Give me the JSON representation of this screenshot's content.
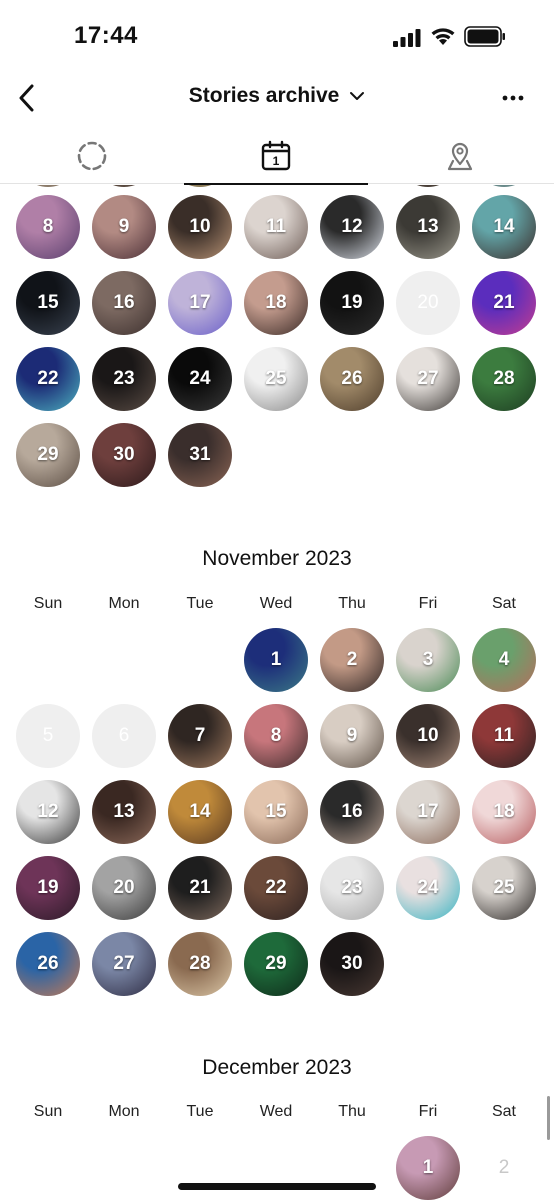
{
  "status_bar": {
    "time": "17:44"
  },
  "header": {
    "title": "Stories archive"
  },
  "tabs": [
    {
      "name": "tab-stories-loading",
      "icon": "dashed-circle-icon",
      "active": false
    },
    {
      "name": "tab-calendar",
      "icon": "calendar-icon",
      "calendar_number": "1",
      "active": true
    },
    {
      "name": "tab-map",
      "icon": "map-pin-icon",
      "active": false
    }
  ],
  "october": {
    "days": [
      {
        "d": "8",
        "c": [
          "#b07fa7",
          "#5a3f6d"
        ]
      },
      {
        "d": "9",
        "c": [
          "#b28a83",
          "#4a2e35"
        ]
      },
      {
        "d": "10",
        "c": [
          "#3a2e28",
          "#b89375"
        ]
      },
      {
        "d": "11",
        "c": [
          "#dcd4cf",
          "#6d5c55"
        ]
      },
      {
        "d": "12",
        "c": [
          "#2a2a2a",
          "#d8dde6"
        ]
      },
      {
        "d": "13",
        "c": [
          "#3c3a35",
          "#9d9a8e"
        ]
      },
      {
        "d": "14",
        "c": [
          "#63a5a8",
          "#3b2d2a"
        ]
      },
      {
        "d": "15",
        "c": [
          "#101318",
          "#3b4452"
        ]
      },
      {
        "d": "16",
        "c": [
          "#7d6a62",
          "#3d302e"
        ]
      },
      {
        "d": "17",
        "c": [
          "#bfb3d9",
          "#6a5fc9"
        ]
      },
      {
        "d": "18",
        "c": [
          "#c49c8e",
          "#3a2a26"
        ]
      },
      {
        "d": "19",
        "c": [
          "#121212",
          "#2d2d2d"
        ]
      },
      {
        "d": "20",
        "c": [],
        "empty": true
      },
      {
        "d": "21",
        "c": [
          "#5b2dbd",
          "#c63d8f"
        ]
      },
      {
        "d": "22",
        "c": [
          "#1c2b76",
          "#4eb3c0"
        ]
      },
      {
        "d": "23",
        "c": [
          "#1a1717",
          "#5b4d45"
        ]
      },
      {
        "d": "24",
        "c": [
          "#0a0a0a",
          "#3a3a3a"
        ]
      },
      {
        "d": "25",
        "c": [
          "#f0f0f0",
          "#8a8a8a"
        ]
      },
      {
        "d": "26",
        "c": [
          "#a28b6a",
          "#4e3d2b"
        ]
      },
      {
        "d": "27",
        "c": [
          "#e5e0dc",
          "#3e3a37"
        ]
      },
      {
        "d": "28",
        "c": [
          "#3c7c3f",
          "#1d3c21"
        ]
      },
      {
        "d": "29",
        "c": [
          "#b7a99b",
          "#5c4e44"
        ]
      },
      {
        "d": "30",
        "c": [
          "#6e3f3d",
          "#2d1a1b"
        ]
      },
      {
        "d": "31",
        "c": [
          "#3a2e2c",
          "#8b6555"
        ]
      }
    ]
  },
  "november": {
    "title": "November 2023",
    "weekdays": [
      "Sun",
      "Mon",
      "Tue",
      "Wed",
      "Thu",
      "Fri",
      "Sat"
    ],
    "days": [
      {
        "d": "",
        "c": [],
        "blank": true
      },
      {
        "d": "",
        "c": [],
        "blank": true
      },
      {
        "d": "",
        "c": [],
        "blank": true
      },
      {
        "d": "1",
        "c": [
          "#1d2e7a",
          "#3c7c86"
        ]
      },
      {
        "d": "2",
        "c": [
          "#c39a86",
          "#2e2524"
        ]
      },
      {
        "d": "3",
        "c": [
          "#d9d3cd",
          "#4a8a55"
        ]
      },
      {
        "d": "4",
        "c": [
          "#6aa06c",
          "#b76d5d"
        ]
      },
      {
        "d": "5",
        "c": [],
        "empty": true
      },
      {
        "d": "6",
        "c": [],
        "empty": true
      },
      {
        "d": "7",
        "c": [
          "#2f2622",
          "#a07a5f"
        ]
      },
      {
        "d": "8",
        "c": [
          "#c7767c",
          "#3e2c2c"
        ]
      },
      {
        "d": "9",
        "c": [
          "#d8cdc3",
          "#5f5247"
        ]
      },
      {
        "d": "10",
        "c": [
          "#3a302c",
          "#a88b7a"
        ]
      },
      {
        "d": "11",
        "c": [
          "#8e3838",
          "#2a2222"
        ]
      },
      {
        "d": "12",
        "c": [
          "#e5e5e5",
          "#3a3a3a"
        ]
      },
      {
        "d": "13",
        "c": [
          "#3a2822",
          "#8d6a5a"
        ]
      },
      {
        "d": "14",
        "c": [
          "#c08a3a",
          "#5a3a22"
        ]
      },
      {
        "d": "15",
        "c": [
          "#e2c4ad",
          "#8a6a58"
        ]
      },
      {
        "d": "16",
        "c": [
          "#2a2a2a",
          "#b39c8e"
        ]
      },
      {
        "d": "17",
        "c": [
          "#dcd6d0",
          "#8b6a5a"
        ]
      },
      {
        "d": "18",
        "c": [
          "#f0d8d8",
          "#b65b5e"
        ]
      },
      {
        "d": "19",
        "c": [
          "#6e3458",
          "#2b1a27"
        ]
      },
      {
        "d": "20",
        "c": [
          "#a3a3a3",
          "#3a3a3a"
        ]
      },
      {
        "d": "21",
        "c": [
          "#1e1e1e",
          "#7f6a5d"
        ]
      },
      {
        "d": "22",
        "c": [
          "#6b4a3a",
          "#2e2221"
        ]
      },
      {
        "d": "23",
        "c": [
          "#e6e6e6",
          "#a8a8a8"
        ]
      },
      {
        "d": "24",
        "c": [
          "#e9e0e0",
          "#38b4c2"
        ]
      },
      {
        "d": "25",
        "c": [
          "#d7d2cd",
          "#2e2a28"
        ]
      },
      {
        "d": "26",
        "c": [
          "#2a64a6",
          "#c47a54"
        ]
      },
      {
        "d": "27",
        "c": [
          "#7b87a6",
          "#2d2b42"
        ]
      },
      {
        "d": "28",
        "c": [
          "#8a6a50",
          "#dcc8a8"
        ]
      },
      {
        "d": "29",
        "c": [
          "#1e6a3a",
          "#0f2a1a"
        ]
      },
      {
        "d": "30",
        "c": [
          "#1a1616",
          "#4a3a34"
        ]
      }
    ]
  },
  "december": {
    "title": "December 2023",
    "weekdays": [
      "Sun",
      "Mon",
      "Tue",
      "Wed",
      "Thu",
      "Fri",
      "Sat"
    ],
    "days": [
      {
        "d": "",
        "c": [],
        "blank": true
      },
      {
        "d": "",
        "c": [],
        "blank": true
      },
      {
        "d": "",
        "c": [],
        "blank": true
      },
      {
        "d": "",
        "c": [],
        "blank": true
      },
      {
        "d": "",
        "c": [],
        "blank": true
      },
      {
        "d": "1",
        "c": [
          "#c79ab4",
          "#5f3c3a"
        ]
      },
      {
        "d": "2",
        "c": [],
        "plain": true
      }
    ]
  }
}
